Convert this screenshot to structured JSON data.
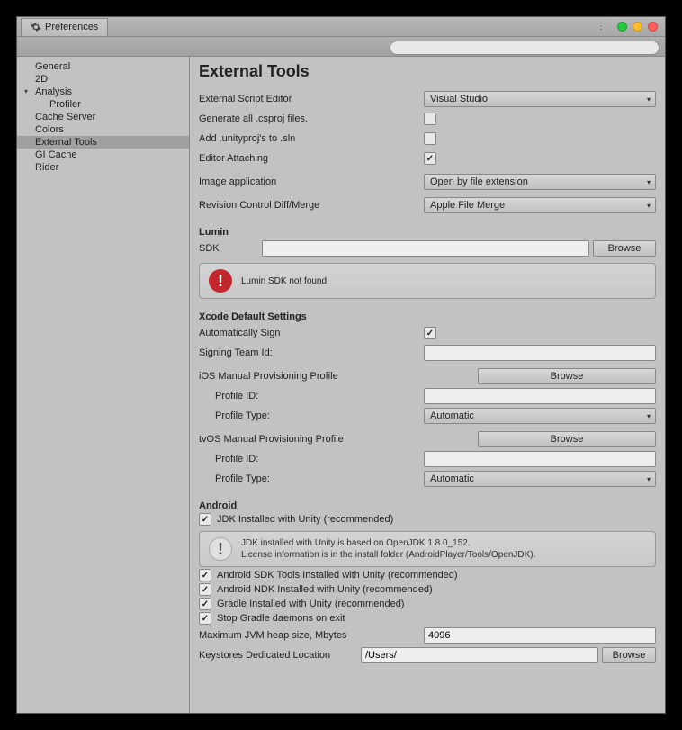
{
  "tab_title": "Preferences",
  "sidebar": {
    "items": [
      {
        "label": "General"
      },
      {
        "label": "2D"
      },
      {
        "label": "Analysis"
      },
      {
        "label": "Profiler"
      },
      {
        "label": "Cache Server"
      },
      {
        "label": "Colors"
      },
      {
        "label": "External Tools"
      },
      {
        "label": "GI Cache"
      },
      {
        "label": "Rider"
      }
    ]
  },
  "page_title": "External Tools",
  "fields": {
    "script_editor_label": "External Script Editor",
    "script_editor_value": "Visual Studio",
    "gen_csproj_label": "Generate all .csproj files.",
    "add_unityproj_label": "Add .unityproj's to .sln",
    "editor_attaching_label": "Editor Attaching",
    "image_app_label": "Image application",
    "image_app_value": "Open by file extension",
    "rev_ctrl_label": "Revision Control Diff/Merge",
    "rev_ctrl_value": "Apple File Merge"
  },
  "lumin": {
    "heading": "Lumin",
    "sdk_label": "SDK",
    "browse": "Browse",
    "warning": "Lumin SDK not found"
  },
  "xcode": {
    "heading": "Xcode Default Settings",
    "auto_sign_label": "Automatically Sign",
    "team_id_label": "Signing Team Id:",
    "ios_heading": "iOS Manual Provisioning Profile",
    "tvos_heading": "tvOS Manual Provisioning Profile",
    "profile_id_label": "Profile ID:",
    "profile_type_label": "Profile Type:",
    "profile_type_value": "Automatic",
    "browse": "Browse"
  },
  "android": {
    "heading": "Android",
    "jdk_label": "JDK Installed with Unity (recommended)",
    "info_line1": "JDK installed with Unity is based on OpenJDK 1.8.0_152.",
    "info_line2": "License information is in the install folder (AndroidPlayer/Tools/OpenJDK).",
    "sdk_label": "Android SDK Tools Installed with Unity (recommended)",
    "ndk_label": "Android NDK Installed with Unity (recommended)",
    "gradle_label": "Gradle Installed with Unity (recommended)",
    "stop_gradle_label": "Stop Gradle daemons on exit",
    "heap_label": "Maximum JVM heap size, Mbytes",
    "heap_value": "4096",
    "keystore_label": "Keystores Dedicated Location",
    "keystore_value": "/Users/",
    "browse": "Browse"
  }
}
